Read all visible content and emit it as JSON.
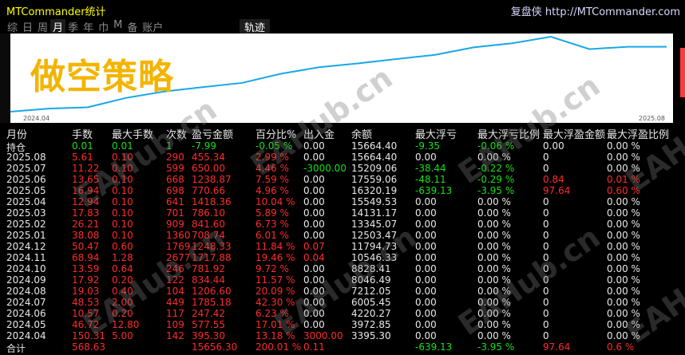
{
  "window": {
    "title": "MTCommander统计",
    "brand": "复盘侠 http://MTCommander.com"
  },
  "tabs": [
    "综",
    "日",
    "周",
    "月",
    "季",
    "年",
    "巾",
    "M",
    "备",
    "账户"
  ],
  "tab_active": "月",
  "track_label": "轨迹",
  "chart": {
    "overlay_title": "做空策略",
    "x_start_label": "2024.04",
    "x_end_label": "2025.08",
    "line_color": "#18a8e6",
    "equity": [
      3395.3,
      3972.85,
      4220.27,
      6005.45,
      7212.05,
      8046.49,
      8828.41,
      10546.33,
      11794.73,
      12503.47,
      13345.07,
      14131.17,
      15549.53,
      16320.19,
      17559.06,
      15209.06,
      15664.4,
      15664.4
    ]
  },
  "headers": [
    "月份",
    "手数",
    "最大手数",
    "次数",
    "盈亏金额",
    "百分比%",
    "出入金",
    "余额",
    "最大浮亏",
    "最大浮亏比例",
    "最大浮盈金额",
    "最大浮盈比例"
  ],
  "rows": [
    [
      "持仓",
      "0.01",
      "0.01",
      "1",
      "-7.99",
      "-0.05 %",
      "0.00",
      "15664.40",
      "-9.35",
      "-0.06 %",
      "0.00",
      "0.00 %"
    ],
    [
      "2025.08",
      "5.61",
      "0.10",
      "290",
      "455.34",
      "2.99 %",
      "0.00",
      "15664.40",
      "0.00",
      "0.00 %",
      "0",
      "0.00 %"
    ],
    [
      "2025.07",
      "11.22",
      "0.10",
      "599",
      "650.00",
      "4.46 %",
      "-3000.00",
      "15209.06",
      "-38.44",
      "-0.22 %",
      "0",
      "0.00 %"
    ],
    [
      "2025.06",
      "13.65",
      "0.10",
      "668",
      "1238.87",
      "7.59 %",
      "0.00",
      "17559.06",
      "-48.11",
      "-0.29 %",
      "0.84",
      "0.01 %"
    ],
    [
      "2025.05",
      "16.94",
      "0.10",
      "698",
      "770.66",
      "4.96 %",
      "0.00",
      "16320.19",
      "-639.13",
      "-3.95 %",
      "97.64",
      "0.60 %"
    ],
    [
      "2025.04",
      "12.94",
      "0.10",
      "641",
      "1418.36",
      "10.04 %",
      "0.00",
      "15549.53",
      "0.00",
      "0.00 %",
      "0",
      "0.00 %"
    ],
    [
      "2025.03",
      "17.83",
      "0.10",
      "701",
      "786.10",
      "5.89 %",
      "0.00",
      "14131.17",
      "0.00",
      "0.00 %",
      "0",
      "0.00 %"
    ],
    [
      "2025.02",
      "26.21",
      "0.10",
      "909",
      "841.60",
      "6.73 %",
      "0.00",
      "13345.07",
      "0.00",
      "0.00 %",
      "0",
      "0.00 %"
    ],
    [
      "2025.01",
      "38.08",
      "0.10",
      "1360",
      "708.74",
      "6.01 %",
      "0.00",
      "12503.47",
      "0.00",
      "0.00 %",
      "0",
      "0.00 %"
    ],
    [
      "2024.12",
      "50.47",
      "0.60",
      "1769",
      "1248.33",
      "11.84 %",
      "0.07",
      "11794.73",
      "0.00",
      "0.00 %",
      "0",
      "0.00 %"
    ],
    [
      "2024.11",
      "68.94",
      "1.28",
      "2677",
      "1717.88",
      "19.46 %",
      "0.04",
      "10546.33",
      "0.00",
      "0.00 %",
      "0",
      "0.00 %"
    ],
    [
      "2024.10",
      "13.59",
      "0.64",
      "246",
      "781.92",
      "9.72 %",
      "0.00",
      "8828.41",
      "0.00",
      "0.00 %",
      "0",
      "0.00 %"
    ],
    [
      "2024.09",
      "17.92",
      "0.20",
      "122",
      "834.44",
      "11.57 %",
      "0.00",
      "8046.49",
      "0.00",
      "0.00 %",
      "0",
      "0.00 %"
    ],
    [
      "2024.08",
      "19.03",
      "0.40",
      "104",
      "1206.60",
      "20.09 %",
      "0.00",
      "7212.05",
      "0.00",
      "0.00 %",
      "0",
      "0.00 %"
    ],
    [
      "2024.07",
      "48.53",
      "2.00",
      "449",
      "1785.18",
      "42.30 %",
      "0.00",
      "6005.45",
      "0.00",
      "0.00 %",
      "0",
      "0.00 %"
    ],
    [
      "2024.06",
      "10.57",
      "0.20",
      "117",
      "247.42",
      "6.23 %",
      "0.00",
      "4220.27",
      "0.00",
      "0.00 %",
      "0",
      "0.00 %"
    ],
    [
      "2024.05",
      "46.72",
      "12.80",
      "109",
      "577.55",
      "17.01 %",
      "0.00",
      "3972.85",
      "0.00",
      "0.00 %",
      "0",
      "0.00 %"
    ],
    [
      "2024.04",
      "150.31",
      "5.00",
      "142",
      "395.30",
      "13.18 %",
      "3000.00",
      "3395.30",
      "0.00",
      "0.00 %",
      "0",
      "0.00 %"
    ],
    [
      "合计",
      "568.63",
      "",
      "",
      "15656.30",
      "200.01 %",
      "0.11",
      "",
      "-639.13",
      "-3.95 %",
      "97.64",
      "0.6 %"
    ]
  ],
  "row_colors": [
    [
      "white",
      "green",
      "green",
      "green",
      "green",
      "green",
      "white",
      "white",
      "green",
      "green",
      "white",
      "white"
    ],
    [
      "white",
      "red",
      "red",
      "red",
      "red",
      "red",
      "white",
      "white",
      "white",
      "white",
      "white",
      "white"
    ],
    [
      "white",
      "red",
      "red",
      "red",
      "red",
      "red",
      "green",
      "white",
      "green",
      "green",
      "white",
      "white"
    ],
    [
      "white",
      "red",
      "red",
      "red",
      "red",
      "red",
      "white",
      "white",
      "green",
      "green",
      "red",
      "red"
    ],
    [
      "white",
      "red",
      "red",
      "red",
      "red",
      "red",
      "white",
      "white",
      "green",
      "green",
      "red",
      "red"
    ],
    [
      "white",
      "red",
      "red",
      "red",
      "red",
      "red",
      "white",
      "white",
      "white",
      "white",
      "white",
      "white"
    ],
    [
      "white",
      "red",
      "red",
      "red",
      "red",
      "red",
      "white",
      "white",
      "white",
      "white",
      "white",
      "white"
    ],
    [
      "white",
      "red",
      "red",
      "red",
      "red",
      "red",
      "white",
      "white",
      "white",
      "white",
      "white",
      "white"
    ],
    [
      "white",
      "red",
      "red",
      "red",
      "red",
      "red",
      "white",
      "white",
      "white",
      "white",
      "white",
      "white"
    ],
    [
      "white",
      "red",
      "red",
      "red",
      "red",
      "red",
      "red",
      "white",
      "white",
      "white",
      "white",
      "white"
    ],
    [
      "white",
      "red",
      "red",
      "red",
      "red",
      "red",
      "red",
      "white",
      "white",
      "white",
      "white",
      "white"
    ],
    [
      "white",
      "red",
      "red",
      "red",
      "red",
      "red",
      "white",
      "white",
      "white",
      "white",
      "white",
      "white"
    ],
    [
      "white",
      "red",
      "red",
      "red",
      "red",
      "red",
      "white",
      "white",
      "white",
      "white",
      "white",
      "white"
    ],
    [
      "white",
      "red",
      "red",
      "red",
      "red",
      "red",
      "white",
      "white",
      "white",
      "white",
      "white",
      "white"
    ],
    [
      "white",
      "red",
      "red",
      "red",
      "red",
      "red",
      "white",
      "white",
      "white",
      "white",
      "white",
      "white"
    ],
    [
      "white",
      "red",
      "red",
      "red",
      "red",
      "red",
      "white",
      "white",
      "white",
      "white",
      "white",
      "white"
    ],
    [
      "white",
      "red",
      "red",
      "red",
      "red",
      "red",
      "white",
      "white",
      "white",
      "white",
      "white",
      "white"
    ],
    [
      "white",
      "red",
      "red",
      "red",
      "red",
      "red",
      "red",
      "white",
      "white",
      "white",
      "white",
      "white"
    ],
    [
      "white",
      "red",
      "red",
      "red",
      "red",
      "red",
      "red",
      "white",
      "green",
      "green",
      "red",
      "red"
    ]
  ],
  "watermark": "EAHub.cn"
}
